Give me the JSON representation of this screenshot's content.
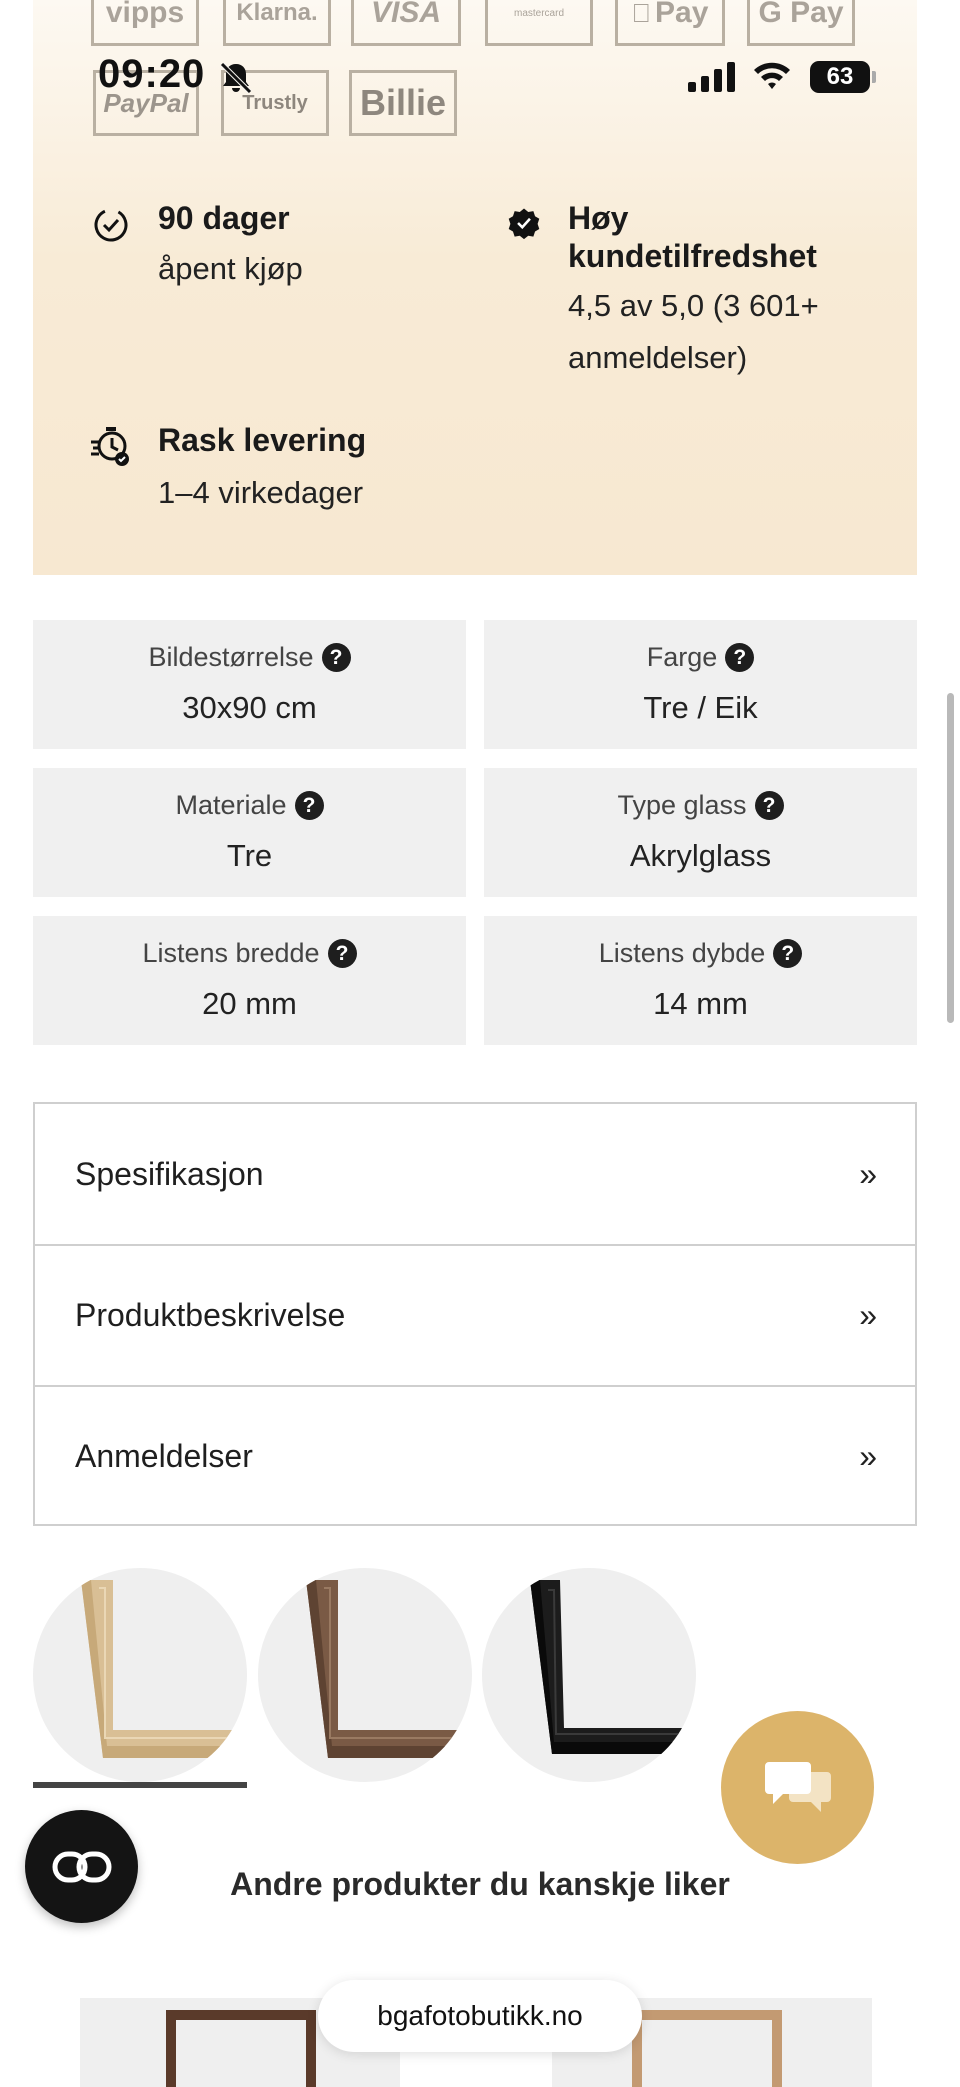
{
  "status_bar": {
    "time": "09:20",
    "battery": "63",
    "icons": [
      "bell-slash-icon",
      "signal-icon",
      "wifi-icon",
      "battery-icon"
    ]
  },
  "payment_logos": [
    "vipps",
    "Klarna.",
    "VISA",
    "mastercard",
    "Pay",
    "G Pay",
    "PayPal",
    "Trustly",
    "Billie"
  ],
  "features": [
    {
      "icon": "clock-check-icon",
      "title": "90 dager",
      "text": "åpent kjøp"
    },
    {
      "icon": "badge-check-icon",
      "title_line1": "Høy",
      "title_line2": "kundetilfredshet",
      "text_line1": "4,5 av 5,0 (3 601+",
      "text_line2": "anmeldelser)"
    },
    {
      "icon": "stopwatch-check-icon",
      "title": "Rask levering",
      "text": "1–4 virkedager"
    }
  ],
  "specs": [
    {
      "label": "Bildestørrelse",
      "value": "30x90 cm"
    },
    {
      "label": "Farge",
      "value": "Tre / Eik"
    },
    {
      "label": "Materiale",
      "value": "Tre"
    },
    {
      "label": "Type glass",
      "value": "Akrylglass"
    },
    {
      "label": "Listens bredde",
      "value": "20 mm"
    },
    {
      "label": "Listens dybde",
      "value": "14 mm"
    }
  ],
  "help_glyph": "?",
  "accordion": [
    {
      "label": "Spesifikasjon",
      "arrow": "»"
    },
    {
      "label": "Produktbeskrivelse",
      "arrow": "»"
    },
    {
      "label": "Anmeldelser",
      "arrow": "»"
    }
  ],
  "swatches": [
    {
      "name": "oak",
      "color": "#d9bf95",
      "selected": true
    },
    {
      "name": "walnut",
      "color": "#7a5a45",
      "selected": false
    },
    {
      "name": "black",
      "color": "#1c1c1c",
      "selected": false
    }
  ],
  "section": {
    "title": "Andre produkter du kanskje liker"
  },
  "browser": {
    "url": "bgafotobutikk.no"
  },
  "colors": {
    "beige": "#f7e8d1",
    "tile": "#f0f0f0",
    "chat": "#dcb46a"
  }
}
